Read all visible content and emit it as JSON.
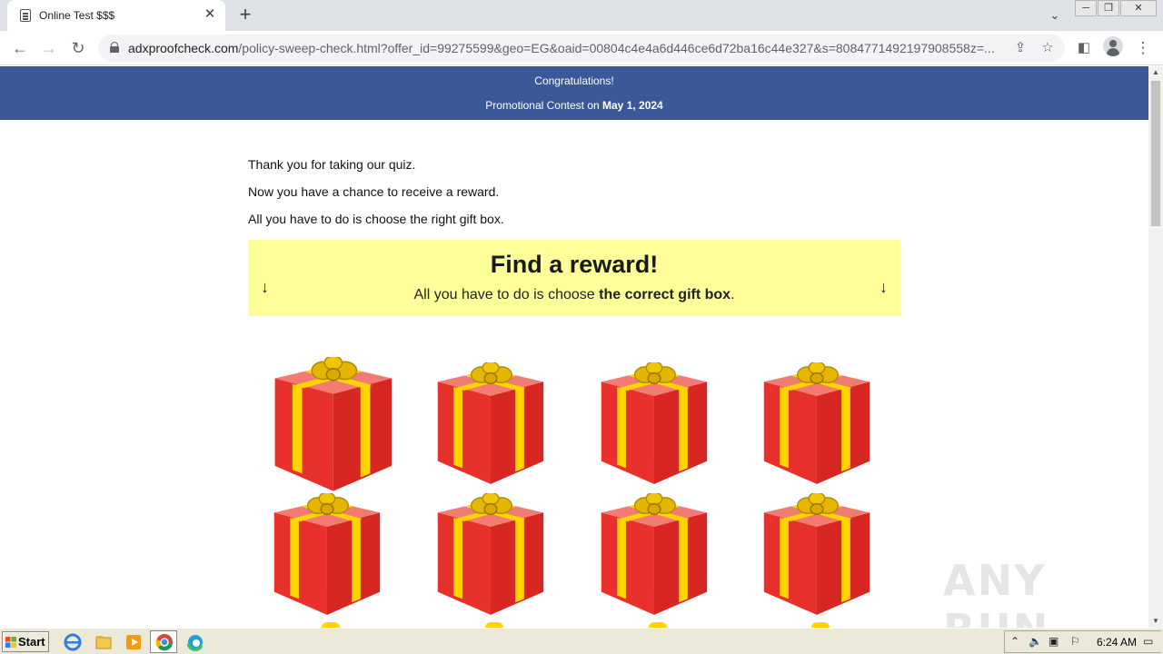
{
  "browser": {
    "tab_title": "Online Test $$$",
    "tab_close": "✕",
    "new_tab": "+",
    "url_host": "adxproofcheck.com",
    "url_rest": "/policy-sweep-check.html?offer_id=99275599&geo=EG&oaid=00804c4e4a6d446ce6d72ba16c44e327&s=8084771492197908558z=...",
    "back": "←",
    "forward": "→",
    "reload": "↻",
    "tab_search": "⌄",
    "win_min": "─",
    "win_max": "❐",
    "win_close": "✕"
  },
  "banner": {
    "line1": "Congratulations!",
    "line2_prefix": "Promotional Contest on ",
    "line2_date": "May 1, 2024"
  },
  "intro": [
    "Thank you for taking our quiz.",
    "Now you have a chance to receive a reward.",
    "All you have to do is choose the right gift box."
  ],
  "reward": {
    "title": "Find a reward!",
    "sub_prefix": "All you have to do is choose ",
    "sub_bold": "the correct gift box",
    "sub_suffix": ".",
    "arrow": "↓"
  },
  "gifts": [
    {
      "label": "gift-box-1"
    },
    {
      "label": "gift-box-2"
    },
    {
      "label": "gift-box-3"
    },
    {
      "label": "gift-box-4"
    },
    {
      "label": "gift-box-5"
    },
    {
      "label": "gift-box-6"
    },
    {
      "label": "gift-box-7"
    },
    {
      "label": "gift-box-8"
    }
  ],
  "colors": {
    "banner": "#3b5998",
    "reward_bg": "#ffff99",
    "gift_red": "#e8302c",
    "gift_ribbon": "#ffd400"
  },
  "watermark": "ANY RUN",
  "taskbar": {
    "start": "Start",
    "clock": "6:24 AM"
  }
}
